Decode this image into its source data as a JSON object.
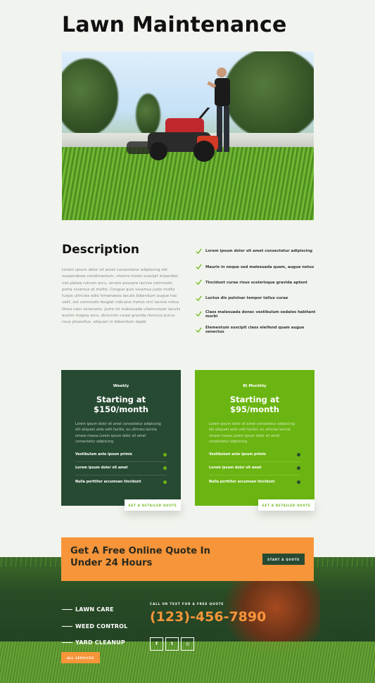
{
  "page": {
    "title": "Lawn Maintenance"
  },
  "description": {
    "heading": "Description",
    "body": "Lorem ipsum dolor sit amet consectetur adipiscing elit suspendisse condimentum, viverra morbi suscipit imperdiet nisl platea rutrum arcu, ornare posuere lacinia commodo porta vivamus et mollis. Congue quis vivamus justo mollis turpis ultricies odio himenaeos iaculis bibendum augue hac velit, est commodo feugiat ridiculus metus orci lacinia netus litora nam venenatis. Justo mi malesuada ullamcorper iaculis auctor magna arcu, dictumst curae gravida rhoncus purus risus phasellus, aliquam in bibendum dapib",
    "checklist": [
      "Lorem ipsum dolor sit amet consectetur adipiscing",
      "Mauris in neque sed malesuada quam, augue netus",
      "Tincidunt curae risus scelerisque gravida aptent",
      "Luctus dis pulvinar tempor tellus curae",
      "Class malesuada donec vestibulum sodales habitant morbi",
      "Elementum suscipit class eleifend quam augue senectus"
    ]
  },
  "plans": [
    {
      "frequency": "Weekly",
      "price_line1": "Starting at",
      "price_line2": "$150/month",
      "lead": "Lorem ipsum dolor sit amet consectetur adipiscing elit aliquam ante velit facilisi, eu ultricies lacinia ornare massa Lorem ipsum dolor sit amet consectetur adipiscing",
      "features": [
        "Vestibulum ante ipsum primis",
        "Lorem ipsum dolor sit amet",
        "Nulla porttitor accumsan tincidunt"
      ],
      "button": "GET A DETAILED QUOTE"
    },
    {
      "frequency": "Bi Monthly",
      "price_line1": "Starting at",
      "price_line2": "$95/month",
      "lead": "Lorem ipsum dolor sit amet consectetur adipiscing elit aliquam ante velit facilisi, eu ultricies lacinia ornare massa Lorem ipsum dolor sit amet consectetur adipiscing",
      "features": [
        "Vestibulum ante ipsum primis",
        "Lorem ipsum dolor sit amet",
        "Nulla porttitor accumsan tincidunt"
      ],
      "button": "GET A DETAILED QUOTE"
    }
  ],
  "cta": {
    "line1": "Get A Free Online Quote In",
    "line2": "Under 24 Hours",
    "button": "START A QUOTE"
  },
  "footer": {
    "services": [
      "LAWN CARE",
      "WEED CONTROL",
      "YARD CLEANUP"
    ],
    "all_services_button": "ALL SERVICES",
    "call_label": "CALL OR TEXT FOR A FREE QUOTE",
    "phone": "(123)-456-7890",
    "socials": [
      {
        "icon": "facebook-icon",
        "glyph": "f"
      },
      {
        "icon": "twitter-icon",
        "glyph": "t"
      },
      {
        "icon": "instagram-icon",
        "glyph": "◎"
      }
    ]
  },
  "colors": {
    "dark_green": "#274a32",
    "lime_green": "#6bb512",
    "orange": "#f7953a",
    "background": "#f1f4ee"
  }
}
